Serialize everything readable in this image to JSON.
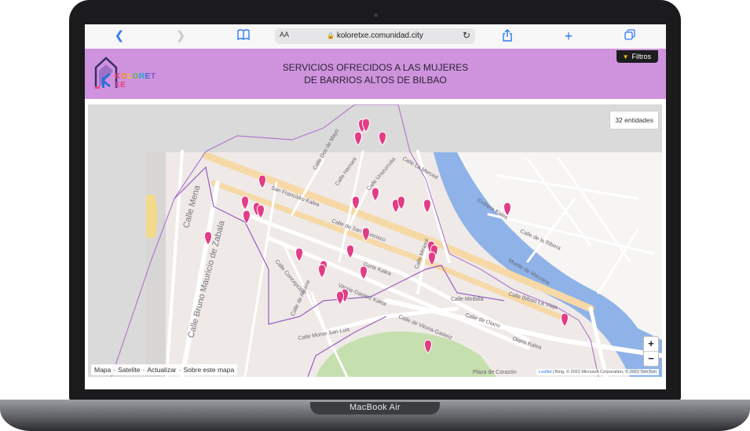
{
  "device": {
    "model_label": "MacBook Air"
  },
  "browser": {
    "aa_label": "AA",
    "url": "koloretxe.comunidad.city",
    "icons": [
      "back-icon",
      "forward-icon",
      "bookmarks-icon",
      "reload-icon",
      "share-icon",
      "add-tab-icon",
      "tabs-icon"
    ]
  },
  "header": {
    "logo_text": "KOLORETXE",
    "title_line1": "SERVICIOS OFRECIDOS A LAS MUJERES",
    "title_line2": "DE BARRIOS ALTOS DE BILBAO",
    "filter_button": "Filtros",
    "background_color": "#cf93de"
  },
  "map": {
    "entity_count": "32 entidades",
    "zoom_in": "+",
    "zoom_out": "−",
    "controls": [
      "Mapa",
      "Satelite",
      "Actualizar",
      "Sobre este mapa"
    ],
    "attribution_leaflet": "Leaflet",
    "attribution_rest": " | Bing, © 2022 Microsoft Corporation, © 2022 TomTom",
    "marker_color": "#e23c86",
    "streets": {
      "s1": "Calle Mena",
      "s2": "Calle Bruno Mauricio de Zabala",
      "s3": "San Francisko Kalea",
      "s4": "Calle de San Francisco",
      "s5": "Gorte Kalea",
      "s6": "Calle de Olano",
      "s7": "Olano Kalea",
      "s8": "Calle Bilbao La Vieja",
      "s9": "Calle de la Ribera",
      "s10": "Erribera Kalea",
      "s11": "Muelle de Marzana",
      "s12": "Calle Miribilla",
      "s13": "Calle Mirasol",
      "s14": "Vitoria-Gasteiz Kalea",
      "s15": "Calle de Vitoria-Gasteiz",
      "s16": "Calle Monte San Luis",
      "s17": "Calle Concepción",
      "s18": "Calle de Aguirre",
      "s19": "Calle La Merced",
      "s20": "Calle Dos de Mayo",
      "s21": "Calle Hernani",
      "s22": "Calle Urazurrutia",
      "s23": "Plaza de Corazón"
    }
  }
}
